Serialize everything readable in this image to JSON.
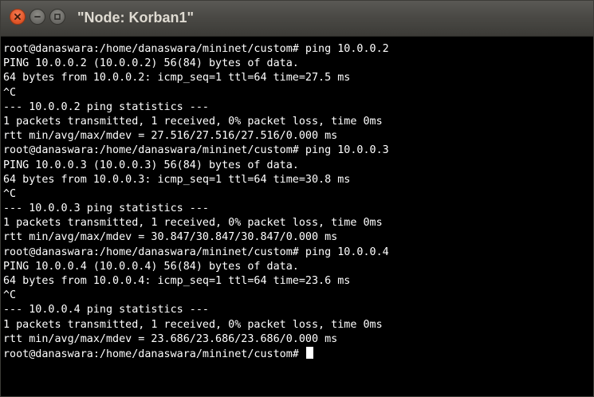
{
  "window": {
    "title": "\"Node: Korban1\""
  },
  "terminal": {
    "lines": [
      "root@danaswara:/home/danaswara/mininet/custom# ping 10.0.0.2",
      "PING 10.0.0.2 (10.0.0.2) 56(84) bytes of data.",
      "64 bytes from 10.0.0.2: icmp_seq=1 ttl=64 time=27.5 ms",
      "^C",
      "--- 10.0.0.2 ping statistics ---",
      "1 packets transmitted, 1 received, 0% packet loss, time 0ms",
      "rtt min/avg/max/mdev = 27.516/27.516/27.516/0.000 ms",
      "root@danaswara:/home/danaswara/mininet/custom# ping 10.0.0.3",
      "PING 10.0.0.3 (10.0.0.3) 56(84) bytes of data.",
      "64 bytes from 10.0.0.3: icmp_seq=1 ttl=64 time=30.8 ms",
      "^C",
      "--- 10.0.0.3 ping statistics ---",
      "1 packets transmitted, 1 received, 0% packet loss, time 0ms",
      "rtt min/avg/max/mdev = 30.847/30.847/30.847/0.000 ms",
      "root@danaswara:/home/danaswara/mininet/custom# ping 10.0.0.4",
      "PING 10.0.0.4 (10.0.0.4) 56(84) bytes of data.",
      "64 bytes from 10.0.0.4: icmp_seq=1 ttl=64 time=23.6 ms",
      "^C",
      "--- 10.0.0.4 ping statistics ---",
      "1 packets transmitted, 1 received, 0% packet loss, time 0ms",
      "rtt min/avg/max/mdev = 23.686/23.686/23.686/0.000 ms"
    ],
    "prompt": "root@danaswara:/home/danaswara/mininet/custom# "
  },
  "controls": {
    "close_icon": "close-icon",
    "minimize_icon": "minimize-icon",
    "maximize_icon": "maximize-icon"
  },
  "colors": {
    "terminal_bg": "#000000",
    "terminal_fg": "#ffffff",
    "titlebar": "#3c3b37",
    "close_button": "#e2582b"
  }
}
